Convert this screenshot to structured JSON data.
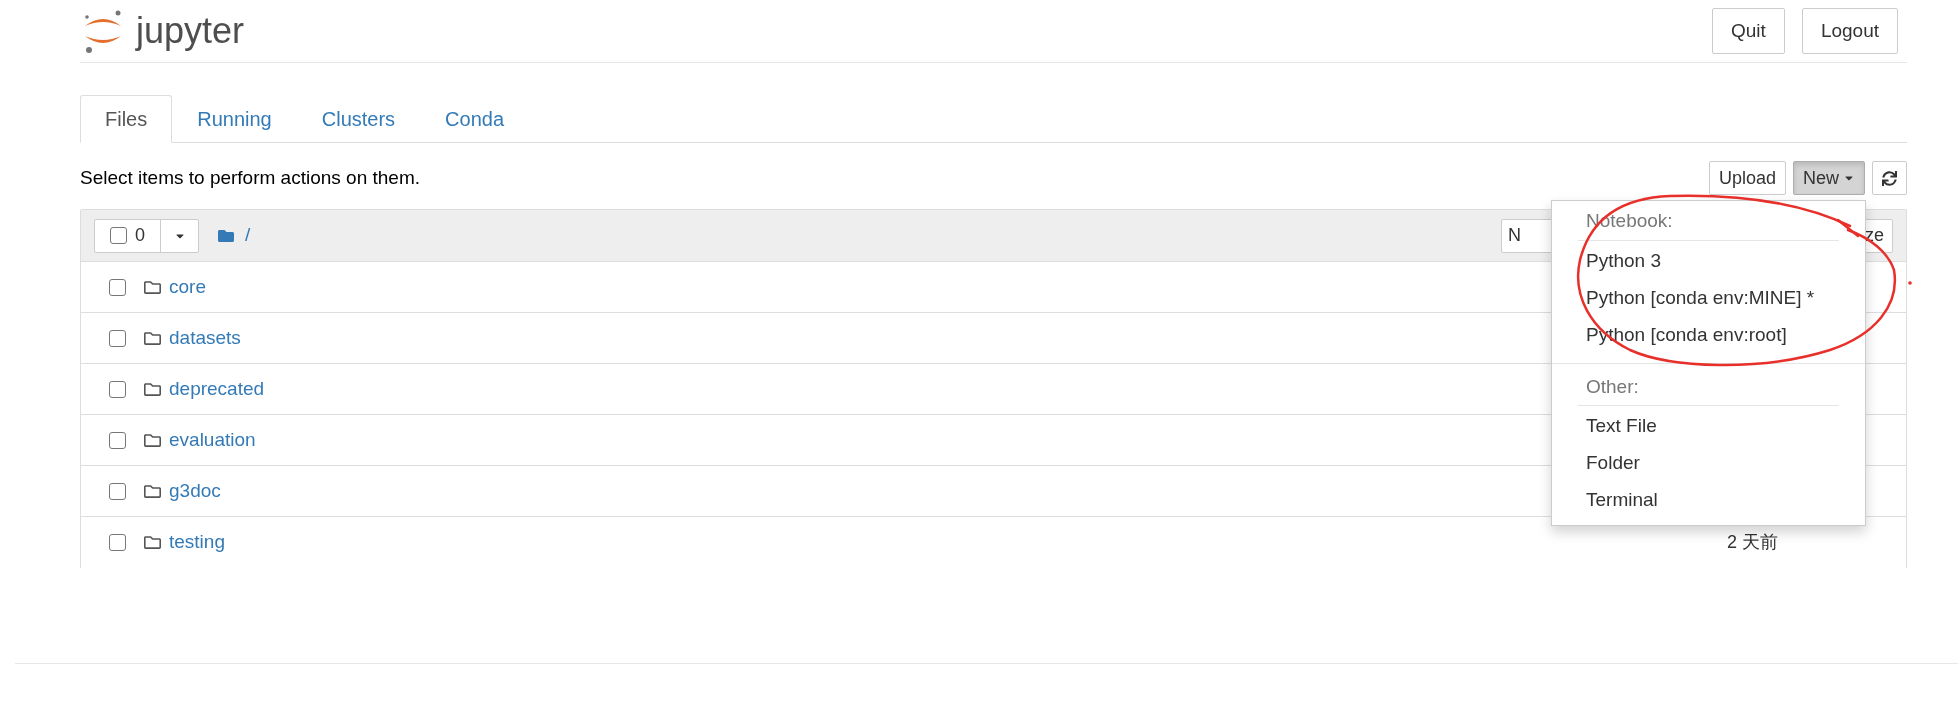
{
  "logo": {
    "wordmark": "jupyter"
  },
  "header_buttons": [
    "Quit",
    "Logout"
  ],
  "tabs": [
    {
      "label": "Files",
      "selected": true
    },
    {
      "label": "Running",
      "selected": false
    },
    {
      "label": "Clusters",
      "selected": false
    },
    {
      "label": "Conda",
      "selected": false
    }
  ],
  "hint": "Select items to perform actions on them.",
  "toolbar": {
    "upload": "Upload",
    "new": {
      "label": "New",
      "open": true
    }
  },
  "list_header": {
    "selected_count": "0",
    "all_checked": false,
    "path": "/",
    "column_buttons": [
      "N",
      "ze"
    ]
  },
  "rows": [
    {
      "name": "core",
      "checked": false,
      "modified": ""
    },
    {
      "name": "datasets",
      "checked": false
    },
    {
      "name": "deprecated",
      "checked": false
    },
    {
      "name": "evaluation",
      "checked": false
    },
    {
      "name": "g3doc",
      "checked": false
    },
    {
      "name": "testing",
      "checked": false,
      "modified": "2 天前"
    }
  ],
  "new_menu": [
    {
      "kind": "header",
      "label": "Notebook:"
    },
    {
      "kind": "item",
      "label": "Python 3"
    },
    {
      "kind": "item",
      "label": "Python [conda env:MINE] *"
    },
    {
      "kind": "item",
      "label": "Python [conda env:root]"
    },
    {
      "kind": "divider"
    },
    {
      "kind": "header",
      "label": "Other:"
    },
    {
      "kind": "item",
      "label": "Text File"
    },
    {
      "kind": "item",
      "label": "Folder"
    },
    {
      "kind": "item",
      "label": "Terminal"
    }
  ]
}
